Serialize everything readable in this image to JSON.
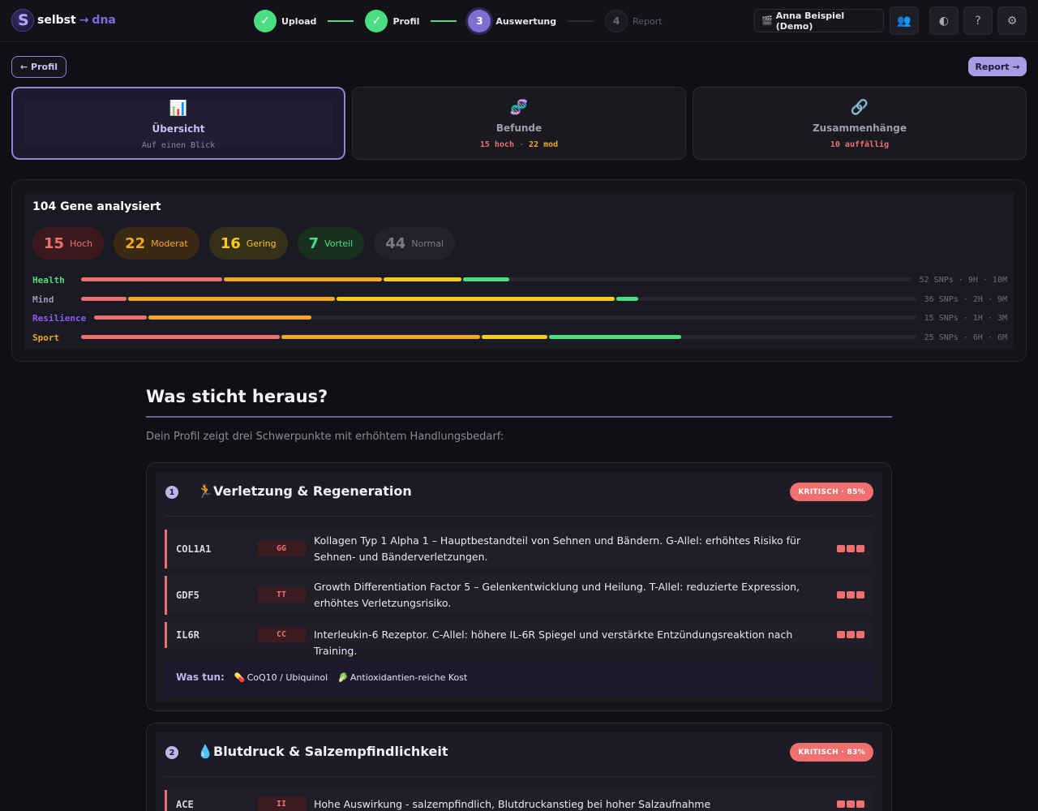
{
  "brand": {
    "part1": "selbst",
    "arrow": "→",
    "part2": "dna"
  },
  "stepper": [
    {
      "label": "Upload",
      "state": "done",
      "mark": "✓"
    },
    {
      "label": "Profil",
      "state": "done",
      "mark": "✓"
    },
    {
      "label": "Auswertung",
      "state": "active",
      "mark": "3"
    },
    {
      "label": "Report",
      "state": "pending",
      "mark": "4"
    }
  ],
  "header": {
    "user_icon": "clapper-icon",
    "user_glyph": "🎬",
    "user_label": "Anna Beispiel (Demo)",
    "btn_users": "👥",
    "btn_theme": "◐",
    "btn_help": "?",
    "btn_settings": "⚙"
  },
  "nav": {
    "back_label": "← Profil",
    "report_label": "Report →"
  },
  "tabs": [
    {
      "icon": "📊",
      "title": "Übersicht",
      "sub": "Auf einen Blick",
      "sub_color": "#8a889a"
    },
    {
      "icon": "🧬",
      "title": "Befunde",
      "sub": "",
      "sub_parts": [
        {
          "text": "15 hoch",
          "color": "#f07070"
        },
        {
          "text": " · ",
          "color": "#8a889a"
        },
        {
          "text": "22 mod",
          "color": "#f5a623"
        }
      ]
    },
    {
      "icon": "🔗",
      "title": "Zusammenhänge",
      "sub": "10 auffällig",
      "sub_color": "#f07070"
    }
  ],
  "summary": {
    "title": "104 Gene analysiert",
    "pills": [
      {
        "num": "15",
        "label": "Hoch",
        "color": "#f0706f",
        "bg": "#3a1a1e"
      },
      {
        "num": "22",
        "label": "Moderat",
        "color": "#f5a623",
        "bg": "#3a2a14"
      },
      {
        "num": "16",
        "label": "Gering",
        "color": "#facc15",
        "bg": "#35301a"
      },
      {
        "num": "7",
        "label": "Vorteil",
        "color": "#4ade80",
        "bg": "#18301f"
      },
      {
        "num": "44",
        "label": "Normal",
        "color": "#7b7988",
        "bg": "#22222a"
      }
    ],
    "categories": [
      {
        "name": "Health",
        "color": "#4ade80",
        "info": "52 SNPs · 9H · 10M",
        "segments": [
          0.172,
          0.192,
          0.096,
          0.058
        ]
      },
      {
        "name": "Mind",
        "color": "#9a98b8",
        "info": "36 SNPs · 2H · 9M",
        "segments": [
          0.056,
          0.25,
          0.335,
          0.028
        ]
      },
      {
        "name": "Resilience",
        "color": "#8b5cf6",
        "info": "15 SNPs · 1H · 3M",
        "segments": [
          0.066,
          0.2
        ]
      },
      {
        "name": "Sport",
        "color": "#f5a623",
        "info": "25 SNPs · 6H · 6M",
        "segments": [
          0.24,
          0.24,
          0.08,
          0.16
        ]
      }
    ],
    "segment_colors": [
      "#f0706f",
      "#f5a623",
      "#facc15",
      "#4ade80"
    ]
  },
  "highlights": {
    "title": "Was sticht heraus?",
    "intro": "Dein Profil zeigt drei Schwerpunkte mit erhöhtem Handlungsbedarf:",
    "clusters": [
      {
        "num": "1",
        "icon": "🏃",
        "title": "Verletzung & Regeneration",
        "badge": "KRITISCH · 85%",
        "genes": [
          {
            "name": "COL1A1",
            "genotype": "GG",
            "desc": "Kollagen Typ 1 Alpha 1 – Hauptbestandteil von Sehnen und Bändern. G-Allel: erhöhtes Risiko für Sehnen- und Bänderverletzungen.",
            "level": 3
          },
          {
            "name": "GDF5",
            "genotype": "TT",
            "desc": "Growth Differentiation Factor 5 – Gelenkentwicklung und Heilung. T-Allel: reduzierte Expression, erhöhtes Verletzungsrisiko.",
            "level": 3
          },
          {
            "name": "IL6R",
            "genotype": "CC",
            "desc": "Interleukin-6 Rezeptor. C-Allel: höhere IL-6R Spiegel und verstärkte Entzündungsreaktion nach Training.",
            "level": 3
          }
        ],
        "todo_label": "Was tun:",
        "todo": [
          {
            "icon": "💊",
            "text": "CoQ10 / Ubiquinol"
          },
          {
            "icon": "🥬",
            "text": "Antioxidantien-reiche Kost"
          }
        ]
      },
      {
        "num": "2",
        "icon": "💧",
        "title": "Blutdruck & Salzempfindlichkeit",
        "badge": "KRITISCH · 83%",
        "genes": [
          {
            "name": "ACE",
            "genotype": "II",
            "desc": "Hohe Auswirkung - salzempfindlich, Blutdruckanstieg bei hoher Salzaufnahme",
            "level": 3
          }
        ]
      }
    ]
  }
}
